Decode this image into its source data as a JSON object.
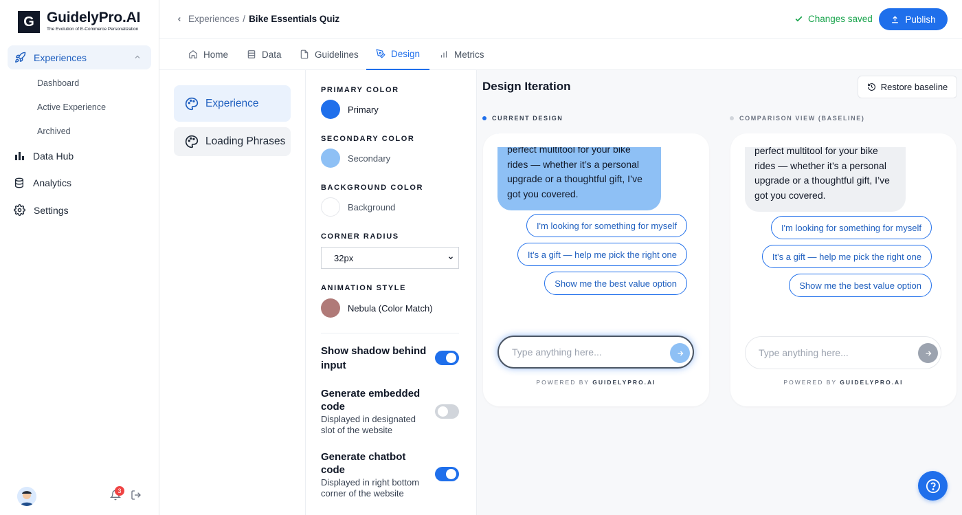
{
  "brand": {
    "logo_letter": "G",
    "name": "GuidelyPro.AI",
    "tagline": "The Evolution of E-Commerce Personalization"
  },
  "sidebar": {
    "experiences_label": "Experiences",
    "sub_items": [
      {
        "label": "Dashboard"
      },
      {
        "label": "Active Experience"
      },
      {
        "label": "Archived"
      }
    ],
    "items": [
      {
        "label": "Data Hub",
        "icon": "bar-chart-icon"
      },
      {
        "label": "Analytics",
        "icon": "database-icon"
      },
      {
        "label": "Settings",
        "icon": "gear-icon"
      }
    ],
    "notification_count": "3"
  },
  "header": {
    "breadcrumb_parent": "Experiences",
    "breadcrumb_sep": "/",
    "breadcrumb_current": "Bike Essentials Quiz",
    "saved_status": "Changes saved",
    "publish_label": "Publish"
  },
  "tabs": [
    {
      "label": "Home",
      "active": false
    },
    {
      "label": "Data",
      "active": false
    },
    {
      "label": "Guidelines",
      "active": false
    },
    {
      "label": "Design",
      "active": true
    },
    {
      "label": "Metrics",
      "active": false
    }
  ],
  "design_sections": [
    {
      "label": "Experience",
      "active": true
    },
    {
      "label": "Loading Phrases",
      "active": false
    }
  ],
  "settings": {
    "primary": {
      "section": "PRIMARY COLOR",
      "value": "Primary",
      "color": "#1f6feb"
    },
    "secondary": {
      "section": "SECONDARY COLOR",
      "value": "Secondary",
      "color": "#8ec0f5"
    },
    "background": {
      "section": "BACKGROUND COLOR",
      "value": "Background",
      "color": "#ffffff"
    },
    "corner_radius": {
      "section": "CORNER RADIUS",
      "value": "32px"
    },
    "animation": {
      "section": "ANIMATION STYLE",
      "value": "Nebula (Color Match)",
      "color": "#b07a78"
    },
    "toggles": [
      {
        "title": "Show shadow behind input",
        "desc": "",
        "on": true
      },
      {
        "title": "Generate embedded code",
        "desc": "Displayed in designated slot of the website",
        "on": false
      },
      {
        "title": "Generate chatbot code",
        "desc": "Displayed in right bottom corner of the website",
        "on": true
      }
    ]
  },
  "preview": {
    "title": "Design Iteration",
    "restore_label": "Restore baseline",
    "current_label": "CURRENT DESIGN",
    "baseline_label": "COMPARISON VIEW (BASELINE)",
    "current_message": "perfect multitool for your bike rides — whether it’s a personal upgrade or a thoughtful gift, I’ve got you covered.",
    "baseline_message": "perfect multitool for your bike rides — whether it’s a personal upgrade or a thoughtful gift, I’ve got you covered.",
    "options": [
      "I'm looking for something for myself",
      "It's a gift — help me pick the right one",
      "Show me the best value option"
    ],
    "input_placeholder": "Type anything here...",
    "powered_prefix": "POWERED BY",
    "powered_brand": "GUIDELYPRO.AI"
  },
  "colors": {
    "accent": "#1f6feb",
    "saved": "#16a34a",
    "bubble_current": "#8ec0f5",
    "bubble_baseline": "#eef0f3"
  }
}
